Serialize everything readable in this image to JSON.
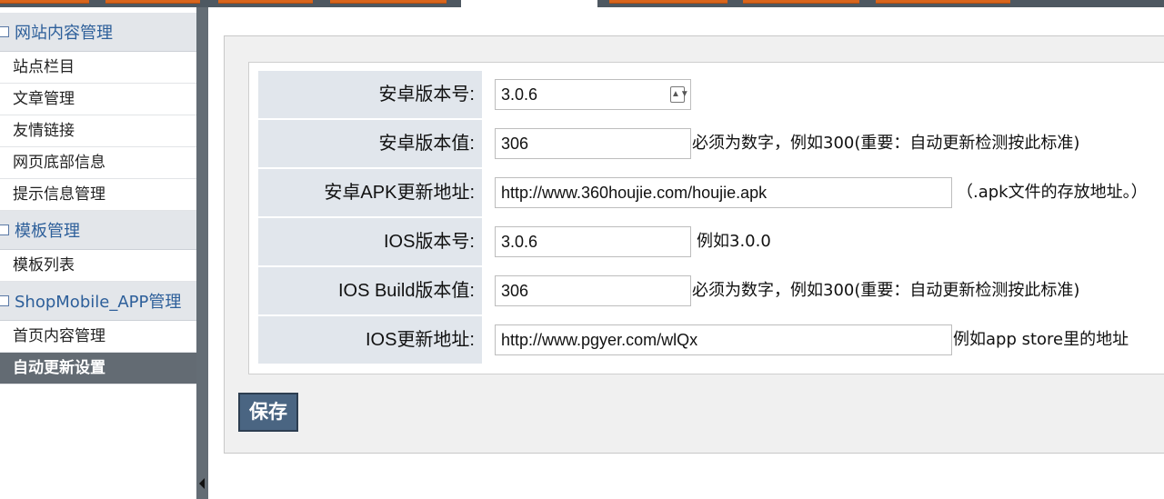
{
  "sidebar": {
    "groups": [
      {
        "title": "网站内容管理",
        "items": [
          "站点栏目",
          "文章管理",
          "友情链接",
          "网页底部信息",
          "提示信息管理"
        ]
      },
      {
        "title": "模板管理",
        "items": [
          "模板列表"
        ]
      },
      {
        "title": "ShopMobile_APP管理",
        "items": [
          "首页内容管理",
          "自动更新设置"
        ]
      }
    ],
    "active_item": "自动更新设置"
  },
  "form": {
    "rows": [
      {
        "label": "安卓版本号:",
        "value": "3.0.6",
        "hint": ""
      },
      {
        "label": "安卓版本值:",
        "value": "306",
        "hint": "必须为数字，例如300(重要：自动更新检测按此标准)"
      },
      {
        "label": "安卓APK更新地址:",
        "value": "http://www.360houjie.com/houjie.apk",
        "hint": "（.apk文件的存放地址。）"
      },
      {
        "label": "IOS版本号:",
        "value": "3.0.6",
        "hint": "例如3.0.0"
      },
      {
        "label": "IOS Build版本值:",
        "value": "306",
        "hint": "必须为数字，例如300(重要：自动更新检测按此标准)"
      },
      {
        "label": "IOS更新地址:",
        "value": "http://www.pgyer.com/wlQx",
        "hint": "例如app store里的地址"
      }
    ],
    "save_label": "保存"
  },
  "colors": {
    "sidebar_active_bg": "#636b73",
    "group_title": "#2d5f9a",
    "label_bg": "#e1e6ec",
    "save_bg": "#4a6582",
    "tab_orange": "#d9651c"
  }
}
